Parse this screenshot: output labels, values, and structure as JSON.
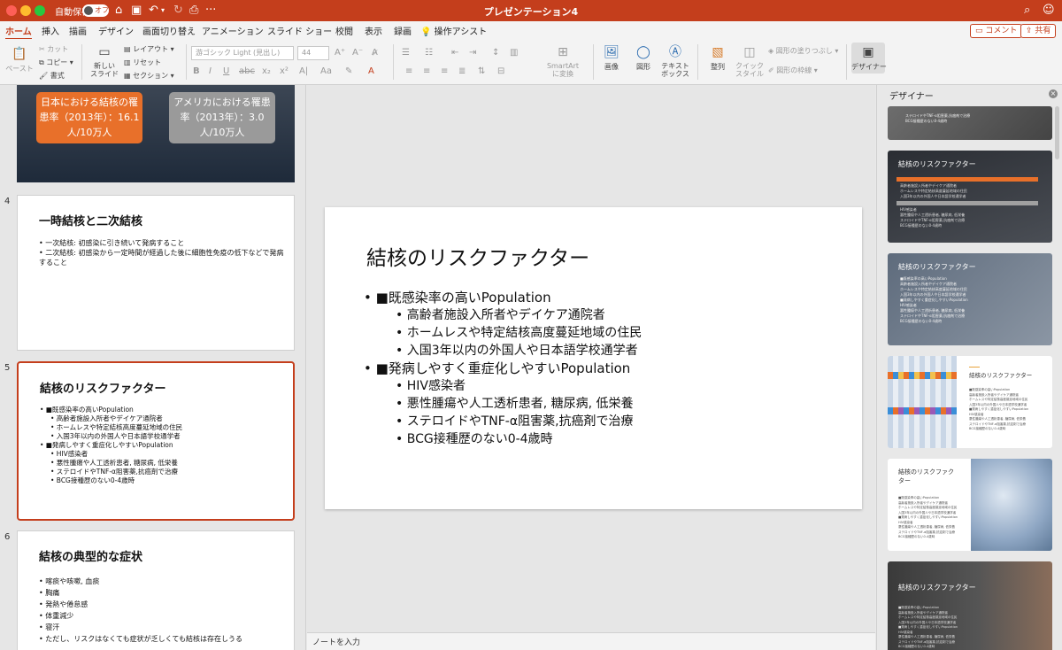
{
  "titlebar": {
    "autosave_label": "自動保存",
    "autosave_state": "オフ",
    "document_title": "プレゼンテーション4"
  },
  "tabs": [
    "ホーム",
    "挿入",
    "描画",
    "デザイン",
    "画面切り替え",
    "アニメーション",
    "スライド ショー",
    "校閲",
    "表示",
    "録画",
    "操作アシスト"
  ],
  "actions": {
    "comment": "コメント",
    "share": "共有"
  },
  "ribbon": {
    "paste": "ペースト",
    "cut": "カット",
    "copy": "コピー",
    "format": "書式",
    "new_slide": "新しい\nスライド",
    "layout": "レイアウト",
    "reset": "リセット",
    "section": "セクション",
    "font_name": "游ゴシック Light (見出し)",
    "font_size": "44",
    "smartart": "SmartArt\nに変換",
    "picture": "画像",
    "shapes": "図形",
    "textbox": "テキスト\nボックス",
    "arrange": "整列",
    "quick_styles": "クイック\nスタイル",
    "shape_fill": "図形の塗りつぶし",
    "shape_outline": "図形の枠線",
    "designer": "デザイナー"
  },
  "thumbnails": {
    "prev_badges": {
      "japan": "日本における結核の罹患率（2013年）：16.1人/10万人",
      "usa": "アメリカにおける罹患率（2013年）：3.0人/10万人"
    },
    "slide4": {
      "number": "4",
      "title": "一時結核と二次結核",
      "bullets": [
        "• 一次結核: 初感染に引き続いて発病すること",
        "• 二次結核: 初感染から一定時間が経過した後に細胞性免疫の低下などで発病すること"
      ]
    },
    "slide5": {
      "number": "5",
      "title": "結核のリスクファクター",
      "lines": [
        {
          "lvl": 1,
          "text": "• ■既感染率の高いPopulation"
        },
        {
          "lvl": 2,
          "text": "• 高齢者施設入所者やデイケア通院者"
        },
        {
          "lvl": 2,
          "text": "• ホームレスや特定結核高度蔓延地域の住民"
        },
        {
          "lvl": 2,
          "text": "• 入国3年以内の外国人や日本語学校通学者"
        },
        {
          "lvl": 1,
          "text": "• ■発病しやすく重症化しやすいPopulation"
        },
        {
          "lvl": 2,
          "text": "• HIV感染者"
        },
        {
          "lvl": 2,
          "text": "• 悪性腫瘍や人工透析患者, 糖尿病, 低栄養"
        },
        {
          "lvl": 2,
          "text": "• ステロイドやTNF-α阻害薬,抗癌剤で治療"
        },
        {
          "lvl": 2,
          "text": "• BCG接種歴のない0-4歳時"
        }
      ]
    },
    "slide6": {
      "number": "6",
      "title": "結核の典型的な症状",
      "bullets": [
        "• 喀痰や咳嗽, 血痰",
        "• 胸痛",
        "• 発熱や倦怠感",
        "• 体重減少",
        "• 寝汗",
        "• ただし、リスクはなくても症状が乏しくても結核は存在しうる"
      ]
    }
  },
  "slide": {
    "title": "結核のリスクファクター",
    "lines": [
      {
        "lvl": 1,
        "text": "• ■既感染率の高いPopulation"
      },
      {
        "lvl": 2,
        "text": "• 高齢者施設入所者やデイケア通院者"
      },
      {
        "lvl": 2,
        "text": "• ホームレスや特定結核高度蔓延地域の住民"
      },
      {
        "lvl": 2,
        "text": "• 入国3年以内の外国人や日本語学校通学者"
      },
      {
        "lvl": 1,
        "text": "• ■発病しやすく重症化しやすいPopulation"
      },
      {
        "lvl": 2,
        "text": "• HIV感染者"
      },
      {
        "lvl": 2,
        "text": "• 悪性腫瘍や人工透析患者, 糖尿病, 低栄養"
      },
      {
        "lvl": 2,
        "text": "• ステロイドやTNF-α阻害薬,抗癌剤で治療"
      },
      {
        "lvl": 2,
        "text": "• BCG接種歴のない0-4歳時"
      }
    ]
  },
  "notes_placeholder": "ノートを入力",
  "designer": {
    "title": "デザイナー",
    "card_title": "結核のリスクファクター",
    "card_title_wrapped": "結核のリスクファク\nター",
    "card_lines": [
      "■既感染率の高いPopulation",
      "高齢者施設入所者やデイケア通院者",
      "ホームレスや特定結核高度蔓延地域の住民",
      "入国3年以内の外国人や日本語学校通学者",
      "■発病しやすく重症化しやすいPopulation",
      "HIV感染者",
      "悪性腫瘍や人工透析患者, 糖尿病, 低栄養",
      "ステロイドやTNF-α阻害薬,抗癌剤で治療",
      "BCG接種歴のない0-4歳時"
    ],
    "card0_lines": [
      "ステロイドやTNF-α阻害薬,抗癌剤で治療",
      "BCG接種歴のない0-4歳時"
    ]
  },
  "colors": {
    "accent": "#c43e1c",
    "orange": "#e8702a",
    "gray_badge": "#9a9a9a"
  }
}
